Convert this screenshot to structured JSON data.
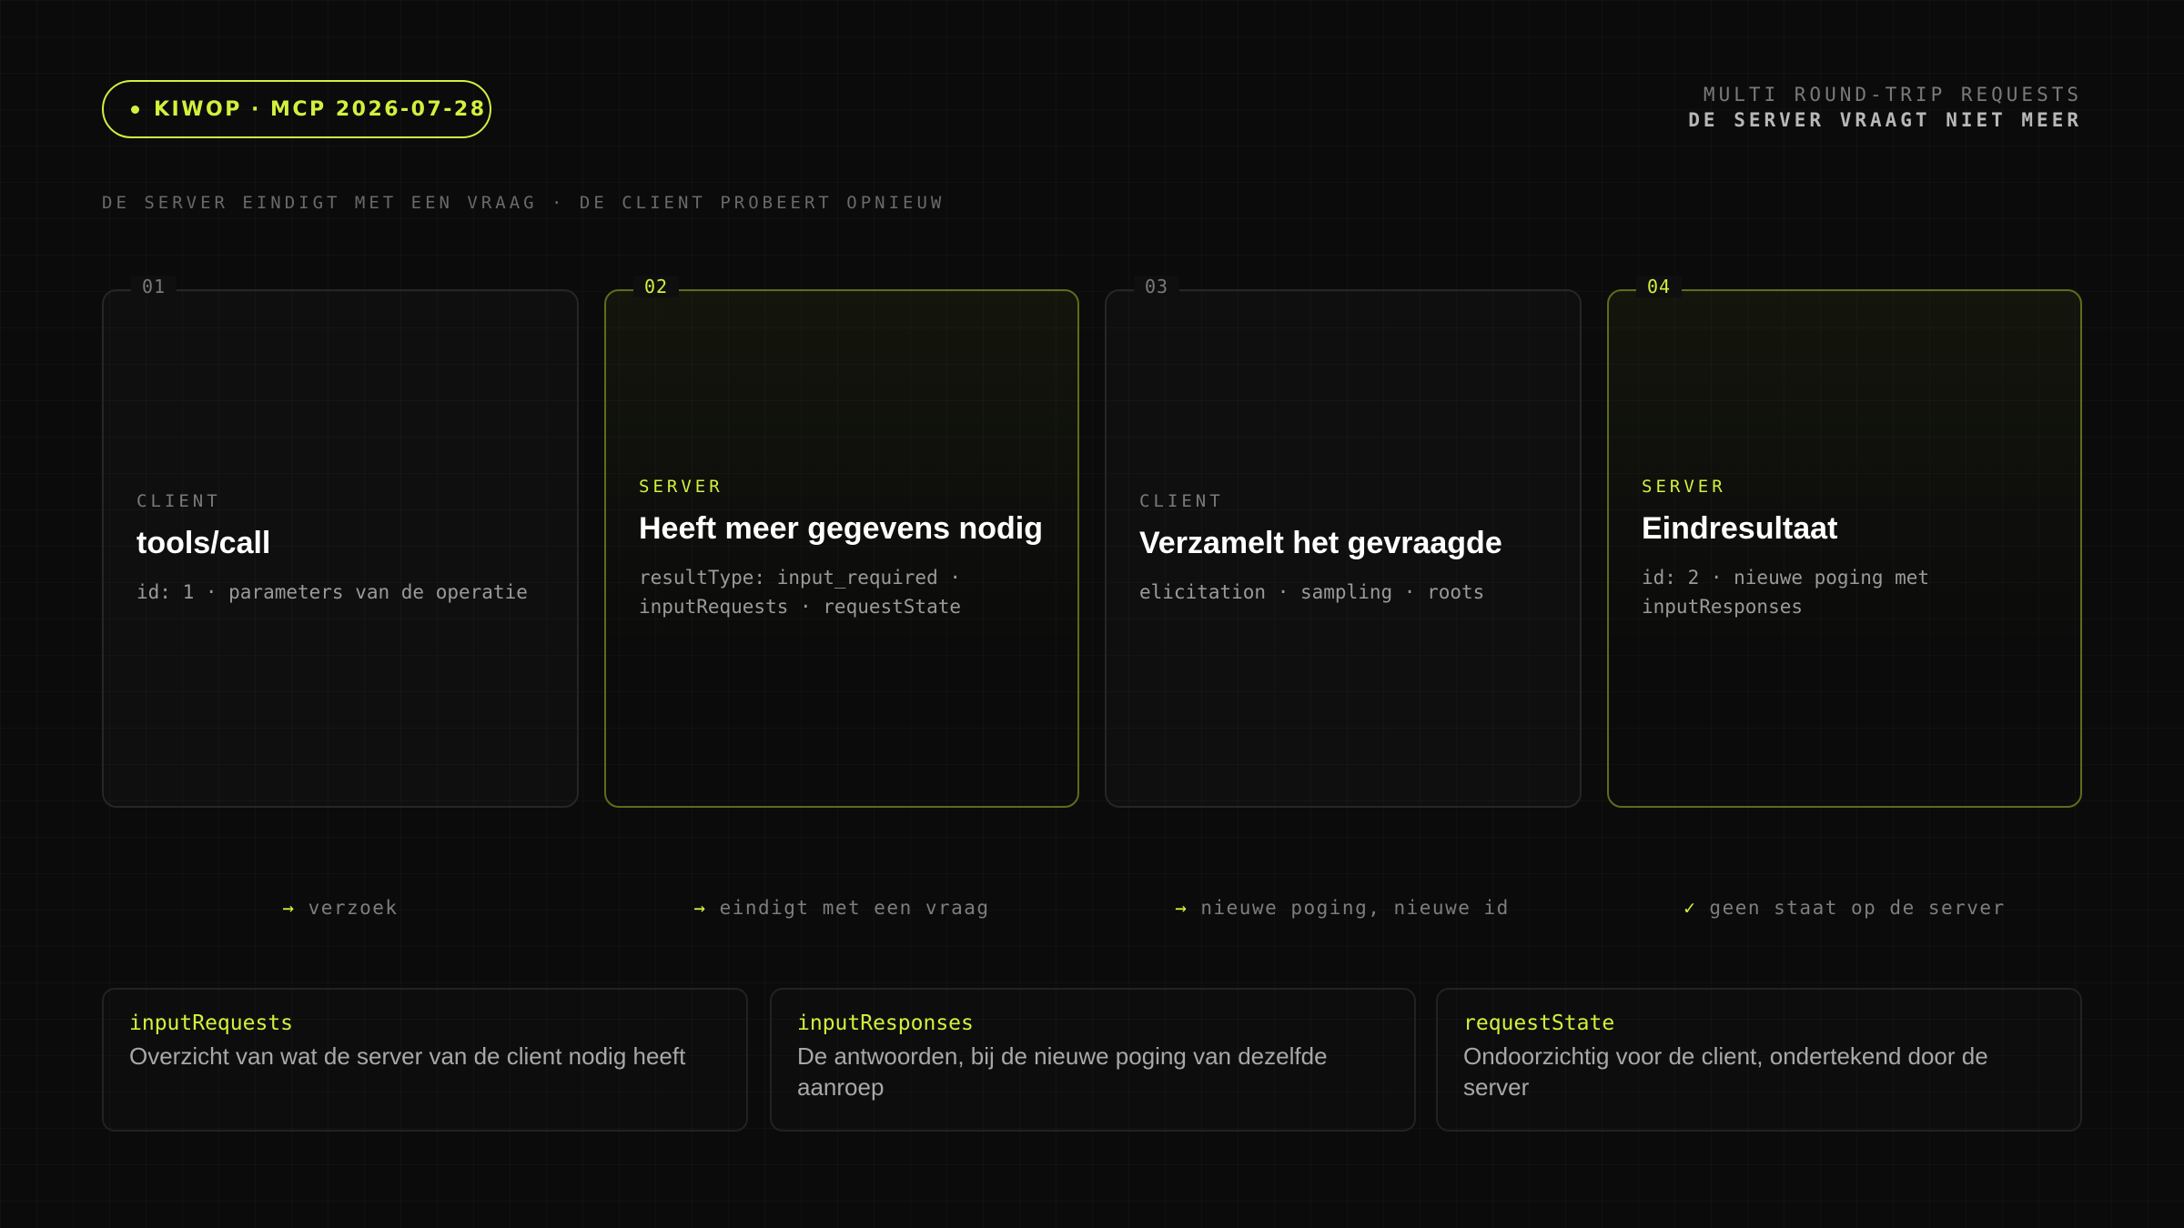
{
  "header": {
    "badge": "KIWOP · MCP 2026-07-28",
    "top_right_line1": "MULTI ROUND-TRIP REQUESTS",
    "top_right_line2": "DE SERVER VRAAGT NIET MEER",
    "subtitle": "DE SERVER EINDIGT MET EEN VRAAG · DE CLIENT PROBEERT OPNIEUW"
  },
  "steps": [
    {
      "num": "01",
      "role": "CLIENT",
      "title": "tools/call",
      "desc": "id: 1 · parameters van de operatie"
    },
    {
      "num": "02",
      "role": "SERVER",
      "title": "Heeft meer gegevens nodig",
      "desc": "resultType: input_required · inputRequests · requestState"
    },
    {
      "num": "03",
      "role": "CLIENT",
      "title": "Verzamelt het gevraagde",
      "desc": "elicitation · sampling · roots"
    },
    {
      "num": "04",
      "role": "SERVER",
      "title": "Eindresultaat",
      "desc": "id: 2 · nieuwe poging met inputResponses"
    }
  ],
  "flow": [
    {
      "icon": "→",
      "label": "verzoek"
    },
    {
      "icon": "→",
      "label": "eindigt met een vraag"
    },
    {
      "icon": "→",
      "label": "nieuwe poging, nieuwe id"
    },
    {
      "icon": "✓",
      "label": "geen staat op de server"
    }
  ],
  "fields": [
    {
      "key": "inputRequests",
      "value": "Overzicht van wat de server van de client nodig heeft"
    },
    {
      "key": "inputResponses",
      "value": "De antwoorden, bij de nieuwe poging van dezelfde aanroep"
    },
    {
      "key": "requestState",
      "value": "Ondoorzichtig voor de client, ondertekend door de server"
    }
  ],
  "colors": {
    "accent": "#d4f03c",
    "background": "#0b0b0b"
  }
}
